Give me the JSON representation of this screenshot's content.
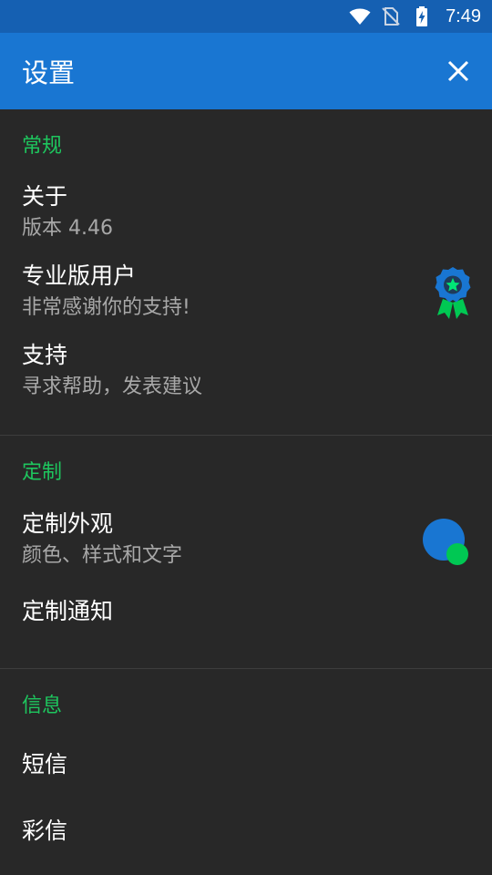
{
  "status_bar": {
    "time": "7:49",
    "icons": [
      "wifi-icon",
      "no-sim-icon",
      "battery-charging-icon"
    ]
  },
  "toolbar": {
    "title": "设置",
    "close_icon": "close-icon"
  },
  "sections": {
    "general": {
      "header": "常规",
      "about": {
        "title": "关于",
        "summary": "版本 4.46"
      },
      "pro": {
        "title": "专业版用户",
        "summary": "非常感谢你的支持!",
        "icon": "award-badge-icon"
      },
      "support": {
        "title": "支持",
        "summary": "寻求帮助，发表建议"
      }
    },
    "customize": {
      "header": "定制",
      "appearance": {
        "title": "定制外观",
        "summary": "颜色、样式和文字",
        "icon": "theme-color-icon"
      },
      "notifications": {
        "title": "定制通知"
      }
    },
    "messages": {
      "header": "信息",
      "sms": {
        "title": "短信"
      },
      "mms": {
        "title": "彩信"
      }
    }
  },
  "colors": {
    "status_bar": "#1560b2",
    "toolbar": "#1976d2",
    "background": "#282828",
    "section_header": "#1ec65e",
    "badge_blue": "#1976d2",
    "badge_green": "#00c853"
  }
}
